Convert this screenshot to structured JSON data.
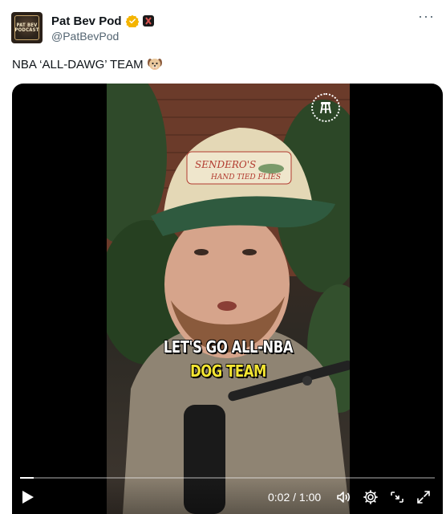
{
  "author": {
    "display_name": "Pat Bev Pod",
    "handle": "@PatBevPod",
    "avatar_text": [
      "PAT BEV",
      "PODCAST"
    ]
  },
  "tweet": {
    "text": "NBA ‘ALL-DAWG’ TEAM",
    "emoji": "dog-face-icon"
  },
  "video": {
    "caption_line1": "LET'S GO ALL-NBA",
    "caption_line2": "DOG TEAM",
    "time_display": "0:02 / 1:00",
    "progress_fraction": 0.033,
    "watermark": "barstool-logo-icon"
  },
  "colors": {
    "verified": "#f4b400",
    "caption_highlight": "#f4e533",
    "muted_text": "#536471"
  },
  "icons": [
    "more-icon",
    "verified-icon",
    "affiliate-badge-icon",
    "play-icon",
    "volume-icon",
    "settings-icon",
    "pip-icon",
    "fullscreen-icon"
  ]
}
